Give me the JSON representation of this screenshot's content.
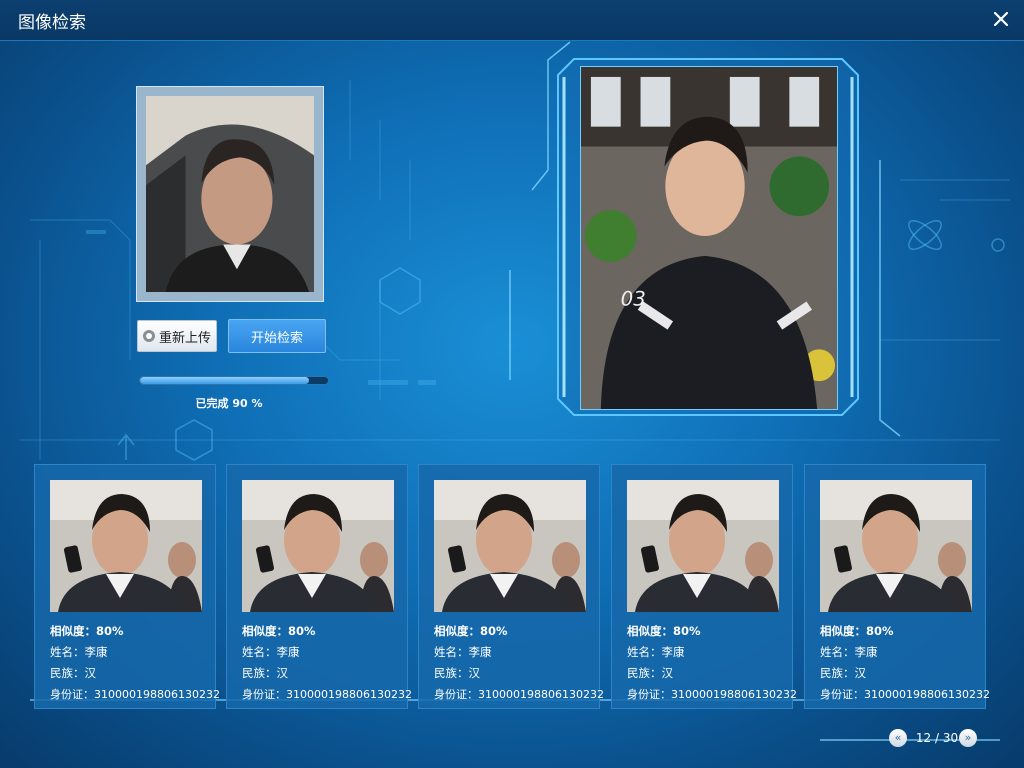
{
  "window": {
    "title": "图像检索",
    "close_icon": "close-icon"
  },
  "actions": {
    "reupload_label": "重新上传",
    "search_label": "开始检索"
  },
  "progress": {
    "percent": 90,
    "text": "已完成 90 %"
  },
  "results": [
    {
      "similarity": "相似度：80%",
      "name": "姓名：李康",
      "ethnicity": "民族：汉",
      "id_number": "身份证：310000198806130232"
    },
    {
      "similarity": "相似度：80%",
      "name": "姓名：李康",
      "ethnicity": "民族：汉",
      "id_number": "身份证：310000198806130232"
    },
    {
      "similarity": "相似度：80%",
      "name": "姓名：李康",
      "ethnicity": "民族：汉",
      "id_number": "身份证：310000198806130232"
    },
    {
      "similarity": "相似度：80%",
      "name": "姓名：李康",
      "ethnicity": "民族：汉",
      "id_number": "身份证：310000198806130232"
    },
    {
      "similarity": "相似度：80%",
      "name": "姓名：李康",
      "ethnicity": "民族：汉",
      "id_number": "身份证：310000198806130232"
    }
  ],
  "pagination": {
    "text": "12 / 30",
    "prev_icon": "double-chevron-left-icon",
    "next_icon": "double-chevron-right-icon"
  },
  "colors": {
    "accent": "#2a85dc",
    "background": "#0f6fb6",
    "card": "#1668aa"
  }
}
